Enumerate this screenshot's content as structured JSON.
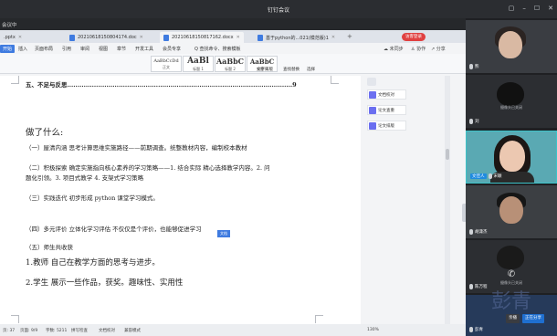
{
  "app": {
    "title": "钉钉会议",
    "status": "会议中",
    "window_controls": {
      "restore": "▢",
      "minimize": "–",
      "maximize": "☐",
      "close": "✕"
    }
  },
  "tabs": [
    {
      "label": ".pptx"
    },
    {
      "label": "2021061815080417​4.doc"
    },
    {
      "label": "2021061815081​7162.docx"
    },
    {
      "label": "基于python的...021(模范版)1"
    }
  ],
  "tab_add": "+",
  "login_label": "访客登录",
  "menu": {
    "start": "开始",
    "items": [
      "插入",
      "页面布局",
      "引用",
      "审阅",
      "视图",
      "章节",
      "开发工具",
      "会员专享",
      "Q 查找命令、搜索模板"
    ],
    "right": [
      "☁ 未同步",
      "♙ 协作",
      "↗ 分享"
    ]
  },
  "ribbon": {
    "styles": [
      {
        "preview": "AaBbCcDd",
        "label": "正文"
      },
      {
        "preview": "AaBl",
        "label": "标题 1"
      },
      {
        "preview": "AaBbC",
        "label": "标题 2"
      },
      {
        "preview": "AaBbC",
        "label": "标题 3"
      }
    ],
    "right_items": [
      "文字排版",
      "查找替换",
      "选择"
    ]
  },
  "document": {
    "toc_line": "五、不足与反思.............................................................................................................9",
    "heading": "做了什么:",
    "lines": [
      "（一）屋清内涵  思考计算思维实施路径——前期调查。统整教材内容，编制校本教材",
      "（二）积极探索  确定实施指向核心素养的学习策略——1. 结合实际  精心选择教学内容。2. 问",
      "题化引领。3. 项目式教学  4. 支架式学习策略",
      "（三）实践迭代  初步形成 python 课堂学习模式。",
      "（四）多元评价  立体化学习评估    不仅仅是个评价，也能够促进学习",
      "（五）师生共收获",
      "1.教师  自己在教学方面的思考与进步。",
      "2.学生  展示一些作品，获奖。趣味性、实用性"
    ],
    "float_tag": "文档"
  },
  "panel": {
    "buttons": [
      "文档校对",
      "论文查重",
      "论文排版"
    ]
  },
  "statusbar": {
    "page": "页: 37",
    "pages": "页面: 9/9",
    "words": "字数: 5211",
    "spell": "拼写检查",
    "proof": "文档校对",
    "compat": "兼容模式",
    "zoom": "130%"
  },
  "participants": [
    {
      "name": "熊",
      "camera": "",
      "active": false
    },
    {
      "name": "刘",
      "camera": "摄像头已关闭",
      "active": false
    },
    {
      "name": "文佳人",
      "extra": "宋颖",
      "camera": "",
      "active": true
    },
    {
      "name": "胡潇杰",
      "camera": "",
      "active": false
    },
    {
      "name": "陈万程",
      "camera": "摄像头已关闭",
      "active": false
    },
    {
      "name": "彭青",
      "camera": "",
      "active": false
    }
  ],
  "bottom": {
    "mute": "亲播",
    "sharing": "正在分享"
  },
  "watermark_text": "彭青"
}
